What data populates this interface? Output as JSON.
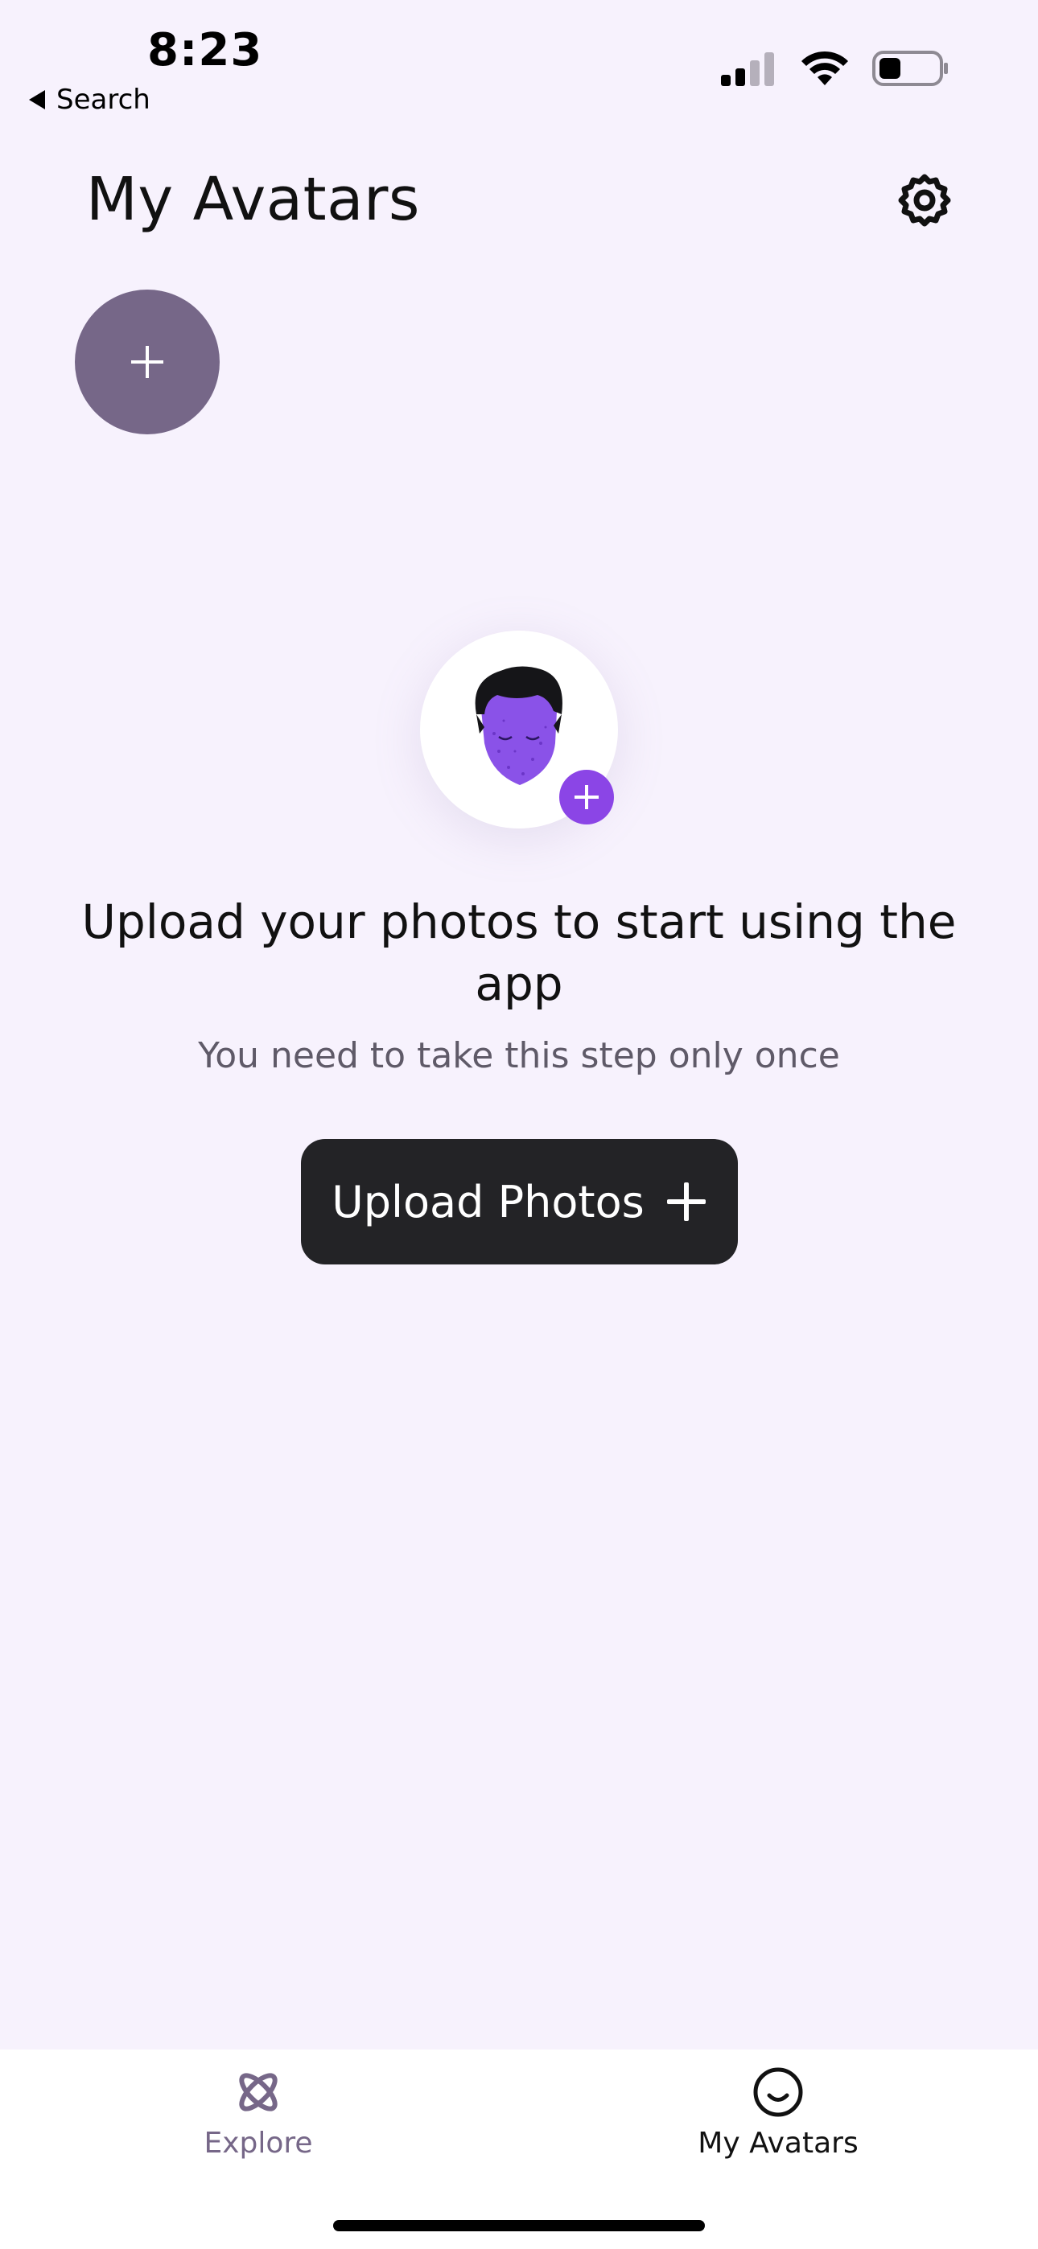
{
  "status_bar": {
    "time": "8:23",
    "back_label": "Search",
    "icons": [
      "cellular-signal-icon",
      "wifi-icon",
      "battery-icon"
    ]
  },
  "header": {
    "title": "My Avatars",
    "settings_icon": "gear-icon",
    "add_avatar_icon": "plus-icon"
  },
  "empty_state": {
    "illustration_icon": "face-avatar-icon",
    "badge_icon": "plus-icon",
    "title": "Upload your photos to start using the app",
    "subtitle": "You need to take this step only once",
    "button_label": "Upload Photos",
    "button_icon": "plus-icon"
  },
  "tab_bar": {
    "tabs": [
      {
        "label": "Explore",
        "icon": "atom-icon",
        "active": false
      },
      {
        "label": "My Avatars",
        "icon": "smiley-icon",
        "active": true
      }
    ]
  },
  "colors": {
    "background": "#f7f2fd",
    "add_avatar_button": "#766788",
    "accent_purple": "#8b45e6",
    "primary_button": "#232326",
    "inactive_tab": "#766788"
  }
}
